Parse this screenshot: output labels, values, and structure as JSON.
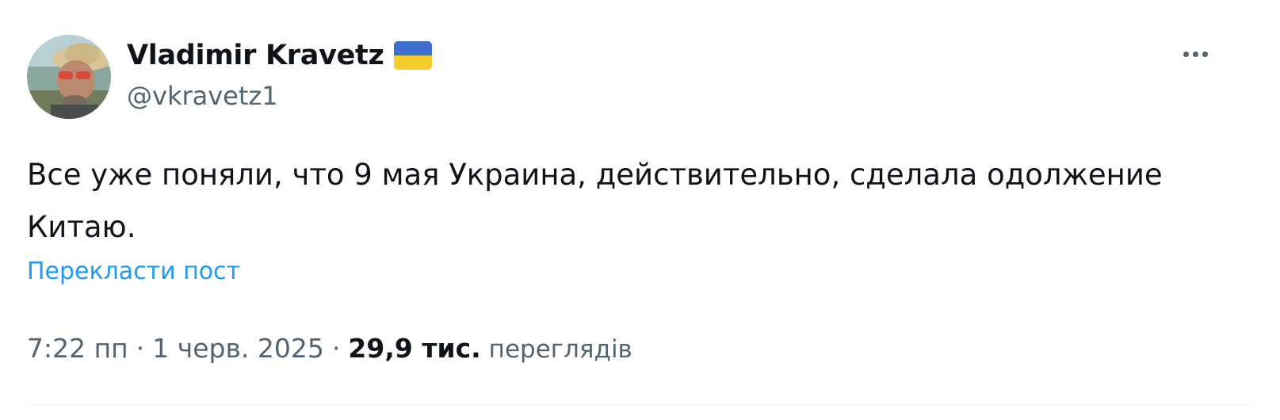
{
  "author": {
    "display_name": "Vladimir Kravetz",
    "handle": "@vkravetz1",
    "flag_icon": "ukraine-flag-icon",
    "flag_colors": {
      "top": "#3d6fd0",
      "bottom": "#f6cc2c"
    }
  },
  "tweet": {
    "text_line1": "Все уже поняли, что 9 мая Украина, действительно, сделала одолжение",
    "text_line2": "Китаю.",
    "translate_label": "Перекласти пост",
    "time": "7:22 пп",
    "separator": "·",
    "date": "1 черв. 2025",
    "views_count": "29,9 тис.",
    "views_label": "переглядів"
  },
  "menu": {
    "icon": "more-horizontal-icon"
  },
  "colors": {
    "text": "#0f1419",
    "muted": "#536471",
    "link": "#1d9bf0",
    "divider": "#eff3f4"
  }
}
